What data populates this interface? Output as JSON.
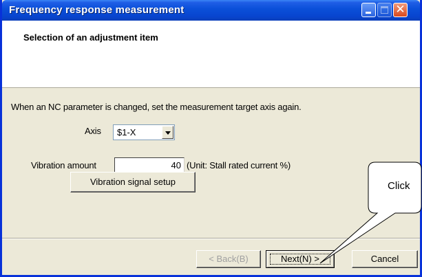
{
  "window": {
    "title": "Frequency response measurement",
    "minimize_icon": "minimize-icon",
    "maximize_icon": "maximize-icon",
    "close_icon": "close-icon"
  },
  "header": {
    "title": "Selection of an adjustment item"
  },
  "main": {
    "note": "When an NC parameter is changed, set the measurement target axis again.",
    "axis": {
      "label": "Axis",
      "value": "$1-X"
    },
    "vibration": {
      "label": "Vibration amount",
      "value": "40",
      "unit": "(Unit: Stall rated current %)"
    },
    "setup_button": "Vibration signal setup"
  },
  "footer": {
    "back": "< Back(B)",
    "next": "Next(N) >",
    "cancel": "Cancel"
  },
  "callout": {
    "text": "Click"
  }
}
